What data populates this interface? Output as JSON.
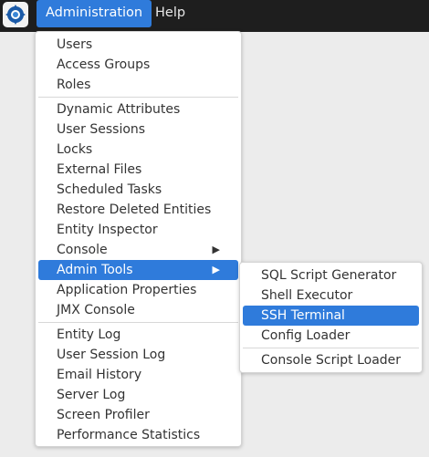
{
  "menubar": {
    "logo_icon": "app-logo-icon",
    "items": [
      {
        "label": "Administration"
      },
      {
        "label": "Help"
      }
    ]
  },
  "admin_menu": {
    "groups": [
      [
        "Users",
        "Access Groups",
        "Roles"
      ],
      [
        "Dynamic Attributes",
        "User Sessions",
        "Locks",
        "External Files",
        "Scheduled Tasks",
        "Restore Deleted Entities",
        "Entity Inspector",
        "Console",
        "Admin Tools",
        "Application Properties",
        "JMX Console"
      ],
      [
        "Entity Log",
        "User Session Log",
        "Email History",
        "Server Log",
        "Screen Profiler",
        "Performance Statistics"
      ]
    ],
    "highlighted": "Admin Tools",
    "submenu_arrow": "▶"
  },
  "admin_tools_submenu": {
    "groups": [
      [
        "SQL Script Generator",
        "Shell Executor",
        "SSH Terminal",
        "Config Loader"
      ],
      [
        "Console Script Loader"
      ]
    ],
    "highlighted": "SSH Terminal"
  },
  "colors": {
    "accent": "#2f7bdb",
    "topbar": "#1e1e1e",
    "background": "#ececec"
  }
}
